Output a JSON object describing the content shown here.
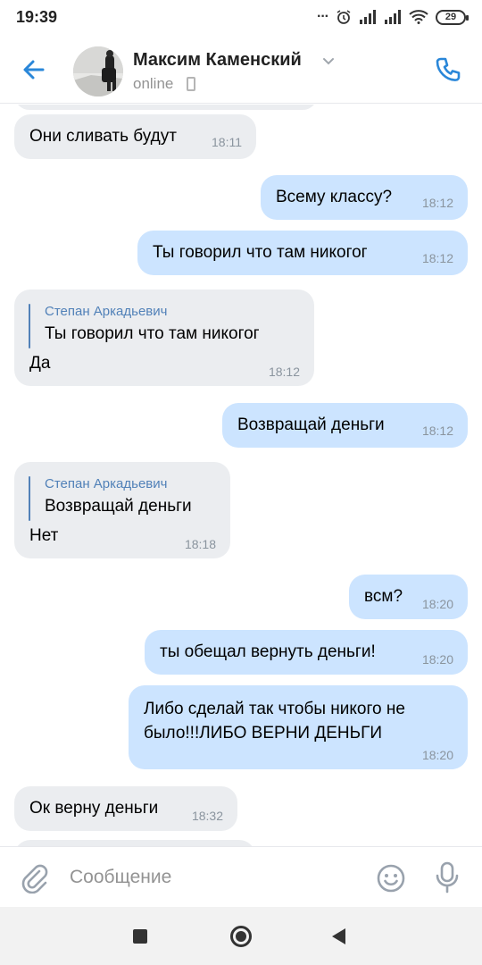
{
  "status_bar": {
    "time": "19:39",
    "battery": "29",
    "icons": [
      "more-dots-icon",
      "alarm-icon",
      "signal-icon",
      "signal-icon",
      "wifi-icon",
      "battery-icon"
    ]
  },
  "header": {
    "contact_name": "Максим Каменский",
    "status": "online",
    "icons": [
      "back-arrow-icon",
      "chevron-down-icon",
      "mobile-device-icon",
      "phone-icon"
    ],
    "accent_color": "#2a87d9"
  },
  "messages": [
    {
      "direction": "in",
      "text": "Они сливать будут",
      "time": "18:11"
    },
    {
      "direction": "out",
      "text": "Всему классу?",
      "time": "18:12"
    },
    {
      "direction": "out",
      "text": "Ты говорил что там никогог",
      "time": "18:12"
    },
    {
      "direction": "in",
      "reply": {
        "author": "Степан Аркадьевич",
        "text": "Ты говорил что там никогог"
      },
      "text": "Да",
      "time": "18:12"
    },
    {
      "direction": "out",
      "text": "Возвращай деньги",
      "time": "18:12"
    },
    {
      "direction": "in",
      "reply": {
        "author": "Степан Аркадьевич",
        "text": "Возвращай деньги"
      },
      "text": "Нет",
      "time": "18:18"
    },
    {
      "direction": "out",
      "text": "всм?",
      "time": "18:20"
    },
    {
      "direction": "out",
      "text": "ты обещал вернуть деньги!",
      "time": "18:20"
    },
    {
      "direction": "out",
      "text_lines": [
        "Либо сделай так чтобы никого не",
        "было!!!ЛИБО ВЕРНИ ДЕНЬГИ"
      ],
      "time": "18:20"
    },
    {
      "direction": "in",
      "text": "Ок верну деньги",
      "time": "18:32"
    }
  ],
  "composer": {
    "placeholder": "Сообщение",
    "icons": [
      "paperclip-icon",
      "emoji-icon",
      "microphone-icon"
    ]
  },
  "colors": {
    "incoming_bubble": "#ebedf0",
    "outgoing_bubble": "#cce4ff",
    "reply_accent": "#5181b8",
    "time_text": "#8a949e"
  },
  "nav_bar": {
    "icons": [
      "recents-square-icon",
      "home-circle-icon",
      "back-triangle-icon"
    ]
  }
}
